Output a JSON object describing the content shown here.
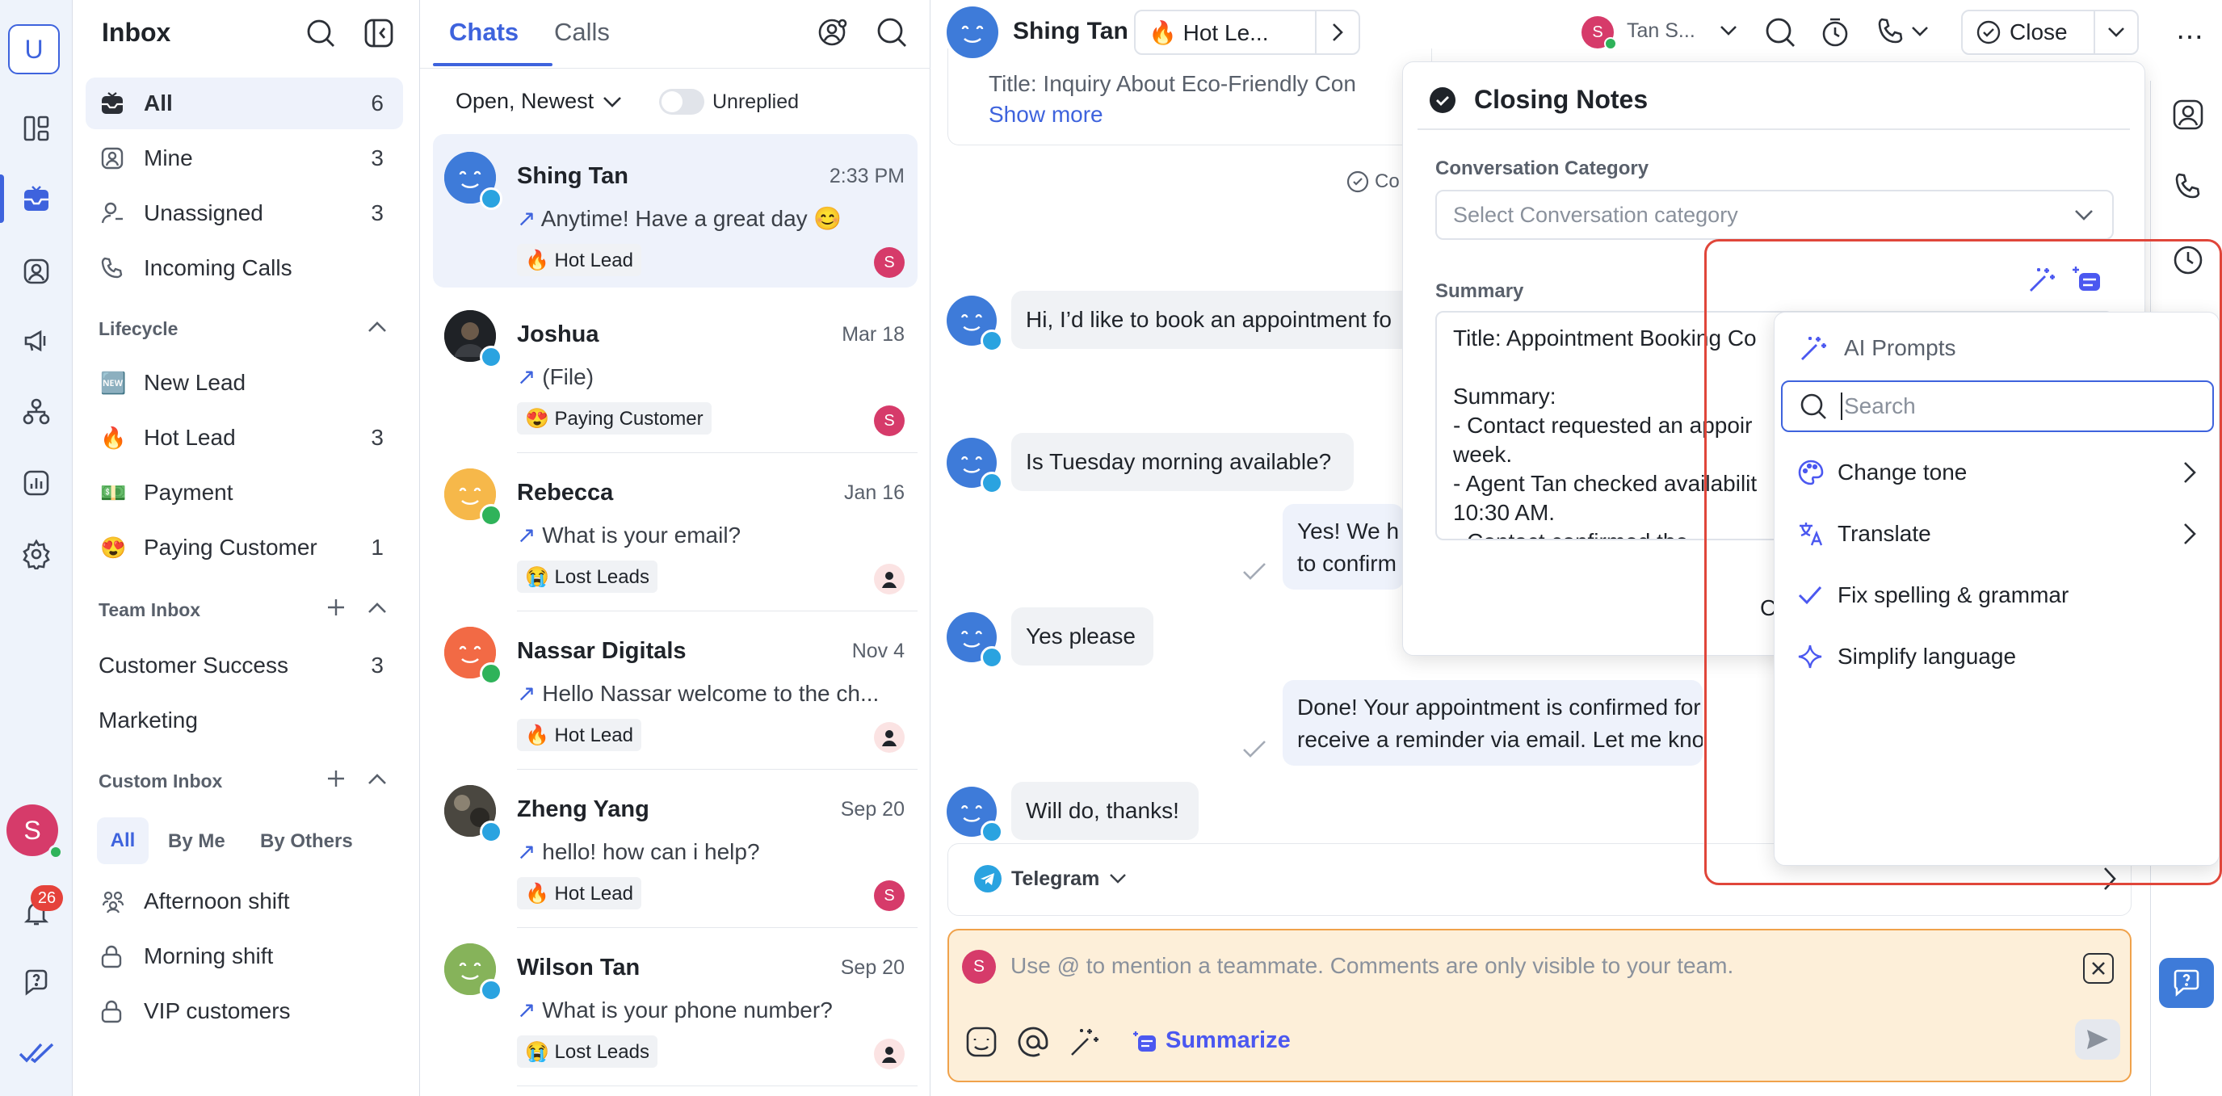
{
  "rail": {
    "logo_letter": "U",
    "user_initial": "S",
    "notifications_count": "26",
    "icons": [
      "logo-icon",
      "dashboard-icon",
      "inbox-icon",
      "contacts-icon",
      "broadcast-icon",
      "workflows-icon",
      "reports-icon",
      "settings-icon",
      "notifications-icon",
      "help-icon",
      "checkmarks-icon"
    ]
  },
  "inbox": {
    "title": "Inbox",
    "items": [
      {
        "label": "All",
        "count": "6"
      },
      {
        "label": "Mine",
        "count": "3"
      },
      {
        "label": "Unassigned",
        "count": "3"
      },
      {
        "label": "Incoming Calls",
        "count": ""
      }
    ],
    "lifecycle_title": "Lifecycle",
    "lifecycle": [
      {
        "emoji": "🆕",
        "label": "New Lead",
        "count": ""
      },
      {
        "emoji": "🔥",
        "label": "Hot Lead",
        "count": "3"
      },
      {
        "emoji": "💵",
        "label": "Payment",
        "count": ""
      },
      {
        "emoji": "😍",
        "label": "Paying Customer",
        "count": "1"
      }
    ],
    "team_title": "Team Inbox",
    "team": [
      {
        "label": "Customer Success",
        "count": "3"
      },
      {
        "label": "Marketing",
        "count": ""
      }
    ],
    "custom_title": "Custom Inbox",
    "custom_filters": [
      "All",
      "By Me",
      "By Others"
    ],
    "custom": [
      {
        "label": "Afternoon shift"
      },
      {
        "label": "Morning shift"
      },
      {
        "label": "VIP customers"
      }
    ]
  },
  "chatlist": {
    "tabs": [
      "Chats",
      "Calls"
    ],
    "filter": "Open, Newest",
    "unreplied_label": "Unreplied",
    "chats": [
      {
        "name": "Shing Tan",
        "date": "2:33 PM",
        "msg": "Anytime! Have a great day 😊",
        "tag": "🔥 Hot Lead",
        "assign": "S"
      },
      {
        "name": "Joshua",
        "date": "Mar 18",
        "msg": "(File)",
        "tag": "😍 Paying Customer",
        "assign": "S"
      },
      {
        "name": "Rebecca",
        "date": "Jan 16",
        "msg": "What is your email?",
        "tag": "😭 Lost Leads",
        "assign": ""
      },
      {
        "name": "Nassar Digitals",
        "date": "Nov 4",
        "msg": "Hello Nassar welcome to the ch...",
        "tag": "🔥 Hot Lead",
        "assign": ""
      },
      {
        "name": "Zheng Yang",
        "date": "Sep 20",
        "msg": "hello! how can i help?",
        "tag": "🔥 Hot Lead",
        "assign": "S"
      },
      {
        "name": "Wilson Tan",
        "date": "Sep 20",
        "msg": "What is your phone number?",
        "tag": "😭 Lost Leads",
        "assign": ""
      }
    ]
  },
  "conversation": {
    "contact_name": "Shing Tan",
    "lifecycle_chip": "🔥  Hot Le...",
    "assignee_initial": "S",
    "assignee_name": "Tan S...",
    "close_label": "Close",
    "prev_card_title": "Title: Inquiry About Eco-Friendly Con",
    "show_more": "Show more",
    "closed_fragment": "Co",
    "messages": [
      {
        "dir": "in",
        "text": "Hi, I’d like to book an appointment fo"
      },
      {
        "dir": "in",
        "text": "Is Tuesday morning available?"
      },
      {
        "dir": "out",
        "lines": [
          "Yes! We h",
          "to confirm"
        ]
      },
      {
        "dir": "in",
        "text": "Yes please"
      },
      {
        "dir": "out",
        "lines": [
          "Done! Your appointment is confirmed for Tues",
          "receive a reminder via email. Let me know if y"
        ]
      },
      {
        "dir": "in",
        "text": "Will do, thanks!"
      }
    ],
    "channel": "Telegram",
    "composer_placeholder": "Use @ to mention a teammate. Comments are only visible to your team.",
    "composer_user_initial": "S",
    "summarize_label": "Summarize"
  },
  "closing_notes": {
    "title": "Closing Notes",
    "category_label": "Conversation Category",
    "category_placeholder": "Select Conversation category",
    "summary_label": "Summary",
    "summary_lines": [
      "Title: Appointment Booking Co",
      "",
      "Summary:",
      "- Contact requested an appoir",
      "week.",
      "- Agent Tan checked availabilit",
      "10:30 AM.",
      "- Contact confirmed the ..."
    ],
    "cut_button_fragment": "C"
  },
  "ai_menu": {
    "title": "AI Prompts",
    "search_placeholder": "Search",
    "items": [
      {
        "label": "Change tone",
        "submenu": true
      },
      {
        "label": "Translate",
        "submenu": true
      },
      {
        "label": "Fix spelling & grammar",
        "submenu": false
      },
      {
        "label": "Simplify language",
        "submenu": false
      }
    ]
  },
  "colors": {
    "accent": "#3e63dd",
    "ai_purple": "#4b58f0",
    "highlight_red": "#e0463a",
    "composer_bg": "#fdefd9",
    "composer_border": "#f0a24b",
    "avatar_pink": "#d63b6a"
  }
}
